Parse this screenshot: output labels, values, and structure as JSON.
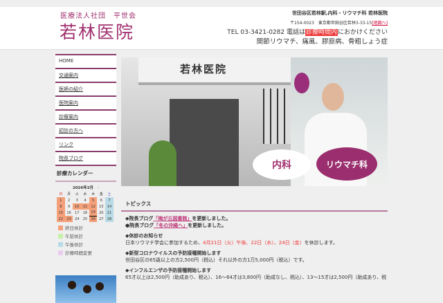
{
  "header": {
    "org": "医療法人社団　平世会",
    "clinic_name": "若林医院",
    "tagline": "世田谷区若林駅,内科・リウマチ科 若林医院",
    "address": "〒154-0023　東京都世田谷区若林3-33-15",
    "map_link": "[地図へ]",
    "tel": "TEL 03-3421-0282 電話は",
    "tel_hours": "診療時間内",
    "tel_suffix": "におかけください",
    "specialties": "関節リウマチ、痛風、膠原病、骨粗しょう症"
  },
  "nav": [
    "HOME",
    "交通案内",
    "医師の紹介",
    "医院案内",
    "診療案内",
    "初診の方へ",
    "リンク",
    "院長ブログ"
  ],
  "calendar": {
    "title": "診療カレンダー",
    "month": "2026年2月",
    "next": "›",
    "weekdays": [
      "日",
      "月",
      "火",
      "水",
      "木",
      "金",
      "土"
    ],
    "weeks": [
      [
        [
          "1",
          "o"
        ],
        [
          "2",
          ""
        ],
        [
          "3",
          ""
        ],
        [
          "4",
          ""
        ],
        [
          "5",
          "o"
        ],
        [
          "6",
          ""
        ],
        [
          "7",
          "b"
        ]
      ],
      [
        [
          "8",
          "o"
        ],
        [
          "9",
          ""
        ],
        [
          "10",
          "o"
        ],
        [
          "11",
          "o"
        ],
        [
          "12",
          "o"
        ],
        [
          "13",
          ""
        ],
        [
          "14",
          "b"
        ]
      ],
      [
        [
          "15",
          "o"
        ],
        [
          "16",
          ""
        ],
        [
          "17",
          ""
        ],
        [
          "18",
          ""
        ],
        [
          "19",
          "o today"
        ],
        [
          "20",
          ""
        ],
        [
          "21",
          "b"
        ]
      ],
      [
        [
          "22",
          "o"
        ],
        [
          "23",
          "o"
        ],
        [
          "24",
          ""
        ],
        [
          "25",
          ""
        ],
        [
          "26",
          "o"
        ],
        [
          "27",
          ""
        ],
        [
          "28",
          "b"
        ]
      ]
    ],
    "legend": [
      {
        "label": "終日休診",
        "color": "#f4a07a"
      },
      {
        "label": "午前休診",
        "color": "#c8f0a8"
      },
      {
        "label": "午後休診",
        "color": "#b9dbe6"
      },
      {
        "label": "診療時間変更",
        "color": "#e8cdef"
      }
    ]
  },
  "hero": {
    "sign": "若林医院",
    "badge1": "内科",
    "badge2": "リウマチ科"
  },
  "topics": {
    "title": "トピックス",
    "blog1_pre": "◆院長ブログ",
    "blog1_link": "「梅が丘図書館」",
    "blog1_post": "を更新しました。",
    "blog2_pre": "●院長ブログ",
    "blog2_link": "「冬の沖縄へ」",
    "blog2_post": "を更新しました。",
    "closed_title": "◆休診のお知らせ",
    "closed_pre": "日本リウマチ学会に参加するため、",
    "closed_dates": "4月21日（火）午後、22日（水）、24日（金）",
    "closed_post": "を休診します。",
    "covid_title": "◆新型コロナウイルスの予防接種開始します",
    "covid_text": "世田谷区の65歳以上の方2,500円（税込）それ以外の方1万5,000円（税込）です。",
    "flu_title": "◆インフルエンザの予防接種開始します",
    "flu_text": "65才以上は2,500円（助成あり、税込）、16～64才は3,800円（助成なし、税込）、13～15才は2,500円（助成あり、税"
  }
}
